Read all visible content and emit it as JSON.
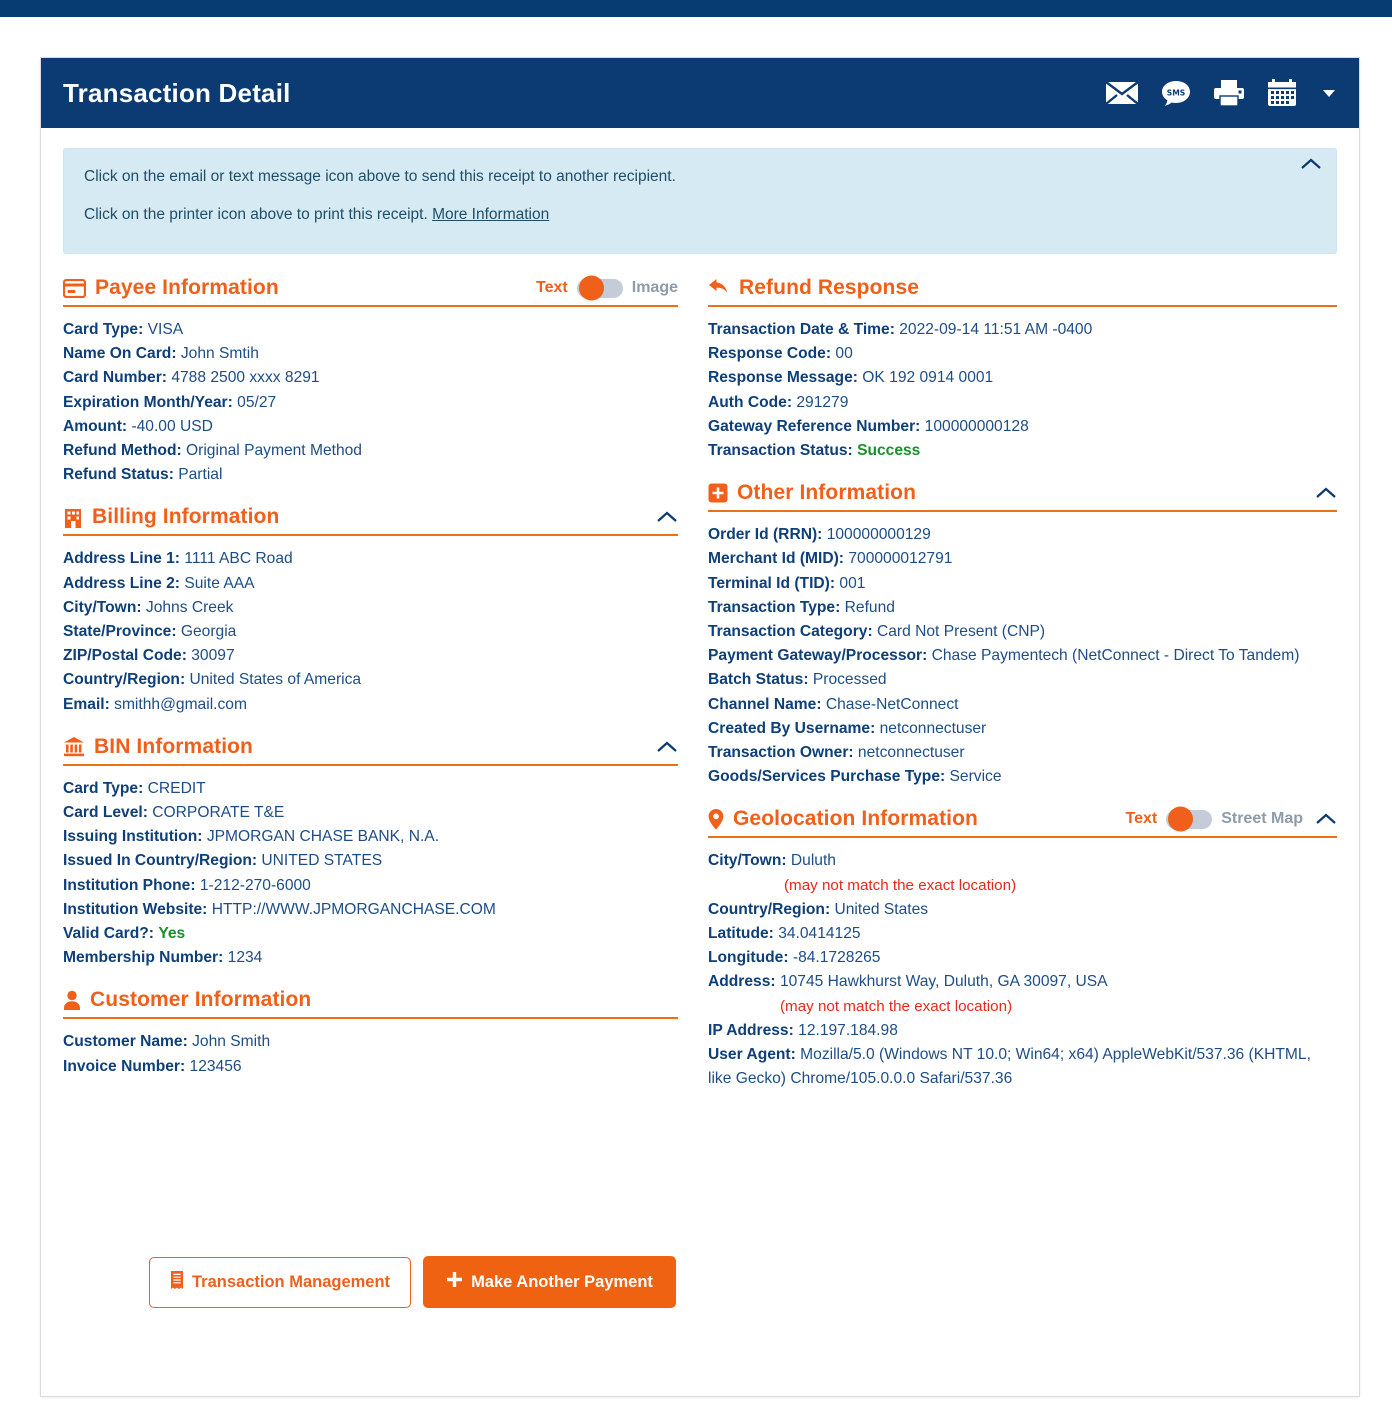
{
  "window": {
    "title": "Transaction Detail",
    "header_icons": [
      {
        "name": "email-icon",
        "label": "Email"
      },
      {
        "name": "sms-icon",
        "label": "SMS"
      },
      {
        "name": "printer-icon",
        "label": "Print"
      },
      {
        "name": "calendar-icon",
        "label": "Calendar"
      }
    ]
  },
  "banner": {
    "line1": "Click on the email or text message icon above to send this receipt to another recipient.",
    "line2_prefix": "Click on the printer icon above to print this receipt. ",
    "more_info_link": "More Information",
    "collapse_icon": "chevron-up-icon"
  },
  "colors": {
    "accent": "#f0601b",
    "header_bg": "#0b3b72",
    "banner_bg": "#d6eaf3",
    "text": "#14447e",
    "success": "#17912c",
    "warning": "#e8281d"
  },
  "sections": {
    "payee": {
      "title": "Payee Information",
      "icon": "credit-card-icon",
      "toggle": {
        "left_label": "Text",
        "right_label": "Image",
        "state": "left"
      },
      "fields": [
        {
          "label": "Card Type:",
          "value": "VISA"
        },
        {
          "label": "Name On Card:",
          "value": "John Smtih"
        },
        {
          "label": "Card Number:",
          "value": "4788 2500 xxxx 8291"
        },
        {
          "label": "Expiration Month/Year:",
          "value": "05/27"
        },
        {
          "label": "Amount:",
          "value": "-40.00 USD"
        },
        {
          "label": "Refund Method:",
          "value": "Original Payment Method"
        },
        {
          "label": "Refund Status:",
          "value": "Partial"
        }
      ]
    },
    "billing": {
      "title": "Billing Information",
      "icon": "building-icon",
      "collapse_icon": "chevron-up-icon",
      "fields": [
        {
          "label": "Address Line 1:",
          "value": "1111 ABC Road"
        },
        {
          "label": "Address Line 2:",
          "value": "Suite AAA"
        },
        {
          "label": "City/Town:",
          "value": "Johns Creek"
        },
        {
          "label": "State/Province:",
          "value": "Georgia"
        },
        {
          "label": "ZIP/Postal Code:",
          "value": "30097"
        },
        {
          "label": "Country/Region:",
          "value": "United States of America"
        },
        {
          "label": "Email:",
          "value": "smithh@gmail.com"
        }
      ]
    },
    "bin": {
      "title": "BIN Information",
      "icon": "bank-icon",
      "collapse_icon": "chevron-up-icon",
      "fields": [
        {
          "label": "Card Type:",
          "value": "CREDIT"
        },
        {
          "label": "Card Level:",
          "value": "CORPORATE T&E"
        },
        {
          "label": "Issuing Institution:",
          "value": "JPMORGAN CHASE BANK, N.A."
        },
        {
          "label": "Issued In Country/Region:",
          "value": "UNITED STATES"
        },
        {
          "label": "Institution Phone:",
          "value": "1-212-270-6000"
        },
        {
          "label": "Institution Website:",
          "value": "HTTP://WWW.JPMORGANCHASE.COM"
        },
        {
          "label": "Valid Card?:",
          "value": "Yes",
          "style": "green"
        },
        {
          "label": "Membership Number:",
          "value": "1234"
        }
      ]
    },
    "customer": {
      "title": "Customer Information",
      "icon": "user-icon",
      "fields": [
        {
          "label": "Customer Name:",
          "value": "John Smith"
        },
        {
          "label": "Invoice Number:",
          "value": "123456"
        }
      ]
    },
    "refund_response": {
      "title": "Refund Response",
      "icon": "undo-arrow-icon",
      "fields": [
        {
          "label": "Transaction Date & Time:",
          "value": "2022-09-14 11:51 AM -0400"
        },
        {
          "label": "Response Code:",
          "value": "00"
        },
        {
          "label": "Response Message:",
          "value": "OK 192 0914 0001"
        },
        {
          "label": "Auth Code:",
          "value": "291279"
        },
        {
          "label": "Gateway Reference Number:",
          "value": "100000000128"
        },
        {
          "label": "Transaction Status:",
          "value": "Success",
          "style": "green"
        }
      ]
    },
    "other": {
      "title": "Other Information",
      "icon": "plus-square-icon",
      "collapse_icon": "chevron-up-icon",
      "fields": [
        {
          "label": "Order Id (RRN):",
          "value": "100000000129"
        },
        {
          "label": "Merchant Id (MID):",
          "value": "700000012791"
        },
        {
          "label": "Terminal Id (TID):",
          "value": "001"
        },
        {
          "label": "Transaction Type:",
          "value": "Refund"
        },
        {
          "label": "Transaction Category:",
          "value": "Card Not Present (CNP)"
        },
        {
          "label": "Payment Gateway/Processor:",
          "value": "Chase Paymentech (NetConnect - Direct To Tandem)"
        },
        {
          "label": "Batch Status:",
          "value": "Processed"
        },
        {
          "label": "Channel Name:",
          "value": "Chase-NetConnect"
        },
        {
          "label": "Created By Username:",
          "value": "netconnectuser"
        },
        {
          "label": "Transaction Owner:",
          "value": "netconnectuser"
        },
        {
          "label": "Goods/Services Purchase Type:",
          "value": "Service"
        }
      ]
    },
    "geolocation": {
      "title": "Geolocation Information",
      "icon": "map-pin-icon",
      "collapse_icon": "chevron-up-icon",
      "toggle": {
        "left_label": "Text",
        "right_label": "Street Map",
        "state": "left"
      },
      "city_label": "City/Town:",
      "city_value": "Duluth",
      "city_note": "(may not match the exact location)",
      "fields_mid": [
        {
          "label": "Country/Region:",
          "value": "United States"
        },
        {
          "label": "Latitude:",
          "value": "34.0414125"
        },
        {
          "label": "Longitude:",
          "value": "-84.1728265"
        }
      ],
      "address_label": "Address:",
      "address_value": "10745 Hawkhurst Way, Duluth, GA 30097, USA",
      "address_note": "(may not match the exact location)",
      "fields_end": [
        {
          "label": "IP Address:",
          "value": "12.197.184.98"
        },
        {
          "label": "User Agent:",
          "value": "Mozilla/5.0 (Windows NT 10.0; Win64; x64) AppleWebKit/537.36 (KHTML, like Gecko) Chrome/105.0.0.0 Safari/537.36"
        }
      ]
    }
  },
  "footer": {
    "transaction_management_label": "Transaction Management",
    "transaction_management_icon": "receipt-icon",
    "make_another_payment_label": "Make Another Payment",
    "make_another_payment_icon": "plus-icon"
  }
}
